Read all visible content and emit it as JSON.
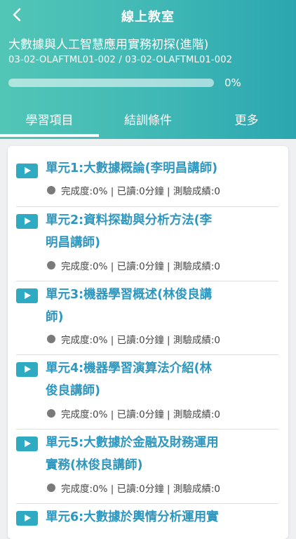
{
  "header": {
    "title": "線上教室",
    "course_name": "大數據與人工智慧應用實務初探(進階)",
    "course_code": "03-02-OLAFTML01-002 / 03-02-OLAFTML01-002",
    "progress_value": 0,
    "progress_text": "0%",
    "background_color": "#3fb7b5"
  },
  "tabs": [
    {
      "label": "學習項目",
      "active": true
    },
    {
      "label": "結訓條件",
      "active": false
    },
    {
      "label": "更多",
      "active": false
    }
  ],
  "units": [
    {
      "line1": "單元1:大數據概論(李明昌講師)",
      "line2": "",
      "meta": "完成度:0% | 已讀:0分鐘 | 測驗成績:0"
    },
    {
      "line1": "單元2:資料探勘與分析方法(李",
      "line2": "明昌講師)",
      "meta": "完成度:0% | 已讀:0分鐘 | 測驗成績:0"
    },
    {
      "line1": "單元3:機器學習概述(林俊良講",
      "line2": "師)",
      "meta": "完成度:0% | 已讀:0分鐘 | 測驗成績:0"
    },
    {
      "line1": "單元4:機器學習演算法介紹(林",
      "line2": "俊良講師)",
      "meta": "完成度:0% | 已讀:0分鐘 | 測驗成績:0"
    },
    {
      "line1": "單元5:大數據於金融及財務運用",
      "line2": "實務(林俊良講師)",
      "meta": "完成度:0% | 已讀:0分鐘 | 測驗成績:0"
    },
    {
      "line1": "單元6:大數據於輿情分析運用實",
      "line2": "",
      "meta": ""
    }
  ],
  "icons": {
    "back": "chevron-left-icon",
    "play": "play-icon",
    "status_dot": "status-dot-icon"
  },
  "colors": {
    "accent": "#2eaac3",
    "unit_title": "#2e97bf"
  }
}
